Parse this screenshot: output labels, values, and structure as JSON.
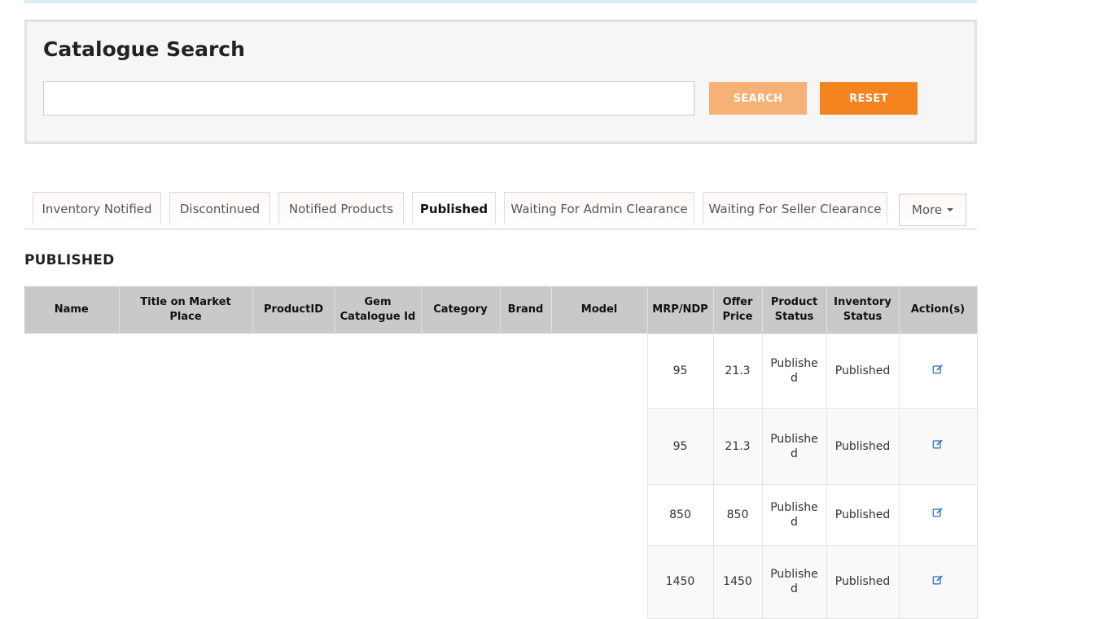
{
  "search": {
    "title": "Catalogue Search",
    "input_value": "",
    "input_placeholder": "",
    "search_label": "SEARCH",
    "reset_label": "RESET"
  },
  "tabs": [
    {
      "label": "Inventory Notified",
      "active": false
    },
    {
      "label": "Discontinued",
      "active": false
    },
    {
      "label": "Notified Products",
      "active": false
    },
    {
      "label": "Published",
      "active": true
    },
    {
      "label": "Waiting For Admin Clearance",
      "active": false
    },
    {
      "label": "Waiting For Seller Clearance",
      "active": false
    }
  ],
  "more_label": "More",
  "section_heading": "PUBLISHED",
  "table": {
    "columns": [
      "Name",
      "Title on Market Place",
      "ProductID",
      "Gem Catalogue Id",
      "Category",
      "Brand",
      "Model",
      "MRP/NDP",
      "Offer Price",
      "Product Status",
      "Inventory Status",
      "Action(s)"
    ],
    "rows": [
      {
        "mrp": "95",
        "offer": "21.3",
        "product_status": "Published",
        "inventory_status": "Published"
      },
      {
        "mrp": "95",
        "offer": "21.3",
        "product_status": "Published",
        "inventory_status": "Published"
      },
      {
        "mrp": "850",
        "offer": "850",
        "product_status": "Published",
        "inventory_status": "Published"
      },
      {
        "mrp": "1450",
        "offer": "1450",
        "product_status": "Published",
        "inventory_status": "Published"
      }
    ]
  },
  "colors": {
    "search_button": "#f5b176",
    "reset_button": "#f58320",
    "header_bg": "#c9c9c9",
    "edit_icon": "#3a7cc4"
  },
  "icons": {
    "edit": "edit-icon",
    "caret": "caret-down-icon"
  }
}
